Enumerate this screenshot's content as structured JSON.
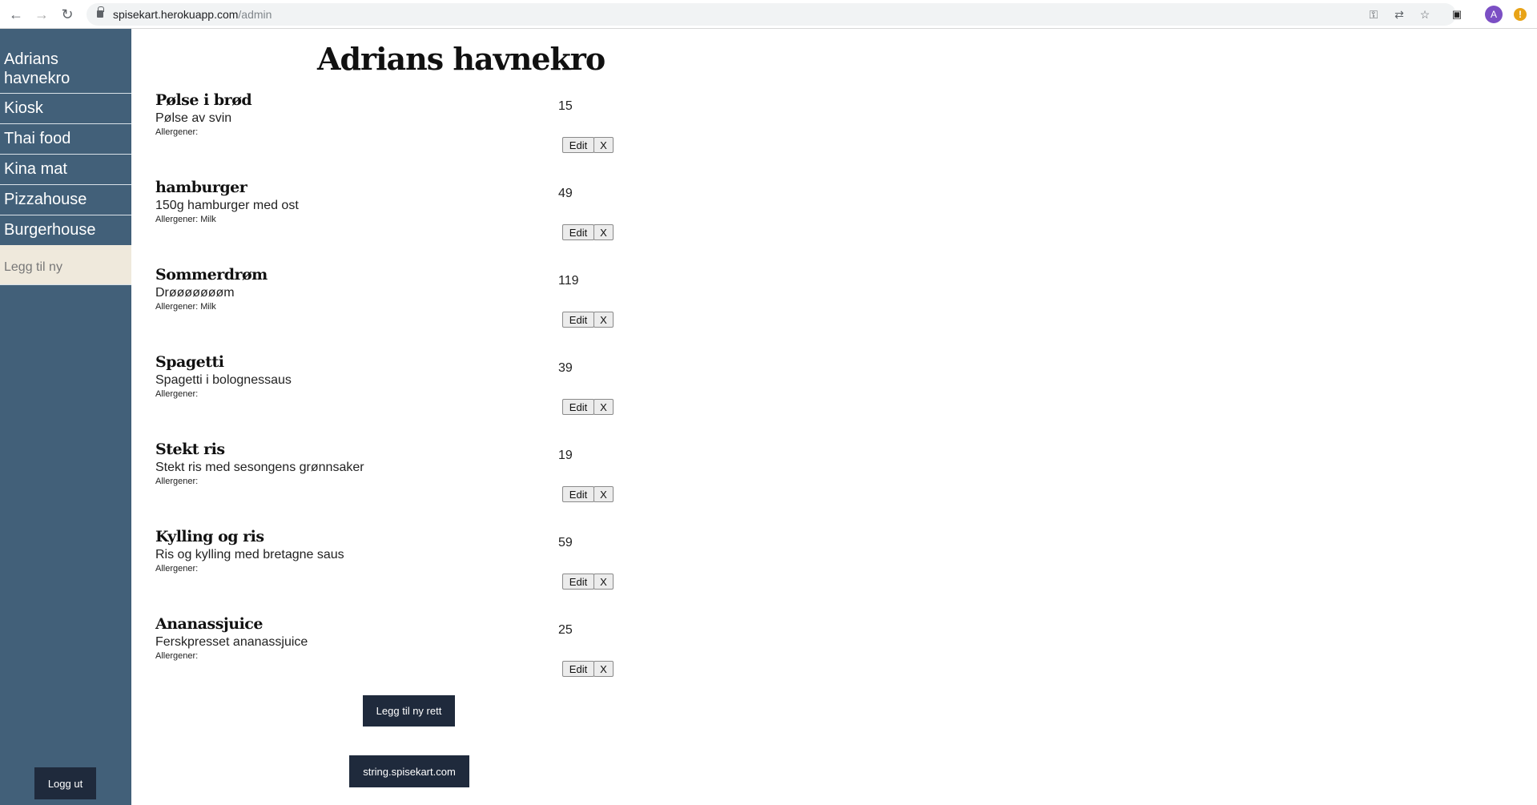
{
  "browser": {
    "url_host": "spisekart.herokuapp.com",
    "url_path": "/admin",
    "avatar_letter": "A",
    "warning_symbol": "!"
  },
  "sidebar": {
    "items": [
      {
        "label": "Adrians havnekro"
      },
      {
        "label": "Kiosk"
      },
      {
        "label": "Thai food"
      },
      {
        "label": "Kina mat"
      },
      {
        "label": "Pizzahouse"
      },
      {
        "label": "Burgerhouse"
      }
    ],
    "new_label": "Legg til ny",
    "logout_label": "Logg ut",
    "colors": {
      "background": "#426079",
      "new_background": "#efe9dc"
    }
  },
  "main": {
    "title": "Adrians havnekro",
    "allergen_prefix": "Allergener:",
    "edit_label": "Edit",
    "delete_label": "X",
    "dishes": [
      {
        "name": "Pølse i brød",
        "description": "Pølse av svin",
        "allergens": "Allergener:",
        "price": "15"
      },
      {
        "name": "hamburger",
        "description": "150g hamburger med ost",
        "allergens": "Allergener: Milk",
        "price": "49"
      },
      {
        "name": "Sommerdrøm",
        "description": "Drøøøøøøøm",
        "allergens": "Allergener: Milk",
        "price": "119"
      },
      {
        "name": "Spagetti",
        "description": "Spagetti i bolognessaus",
        "allergens": "Allergener:",
        "price": "39"
      },
      {
        "name": "Stekt ris",
        "description": "Stekt ris med sesongens grønnsaker",
        "allergens": "Allergener:",
        "price": "19"
      },
      {
        "name": "Kylling og ris",
        "description": "Ris og kylling med bretagne saus",
        "allergens": "Allergener:",
        "price": "59"
      },
      {
        "name": "Ananassjuice",
        "description": "Ferskpresset ananassjuice",
        "allergens": "Allergener:",
        "price": "25"
      }
    ],
    "add_dish_label": "Legg til ny rett",
    "link_button_label": "string.spisekart.com",
    "colors": {
      "dark_button": "#1f2a3c"
    }
  }
}
